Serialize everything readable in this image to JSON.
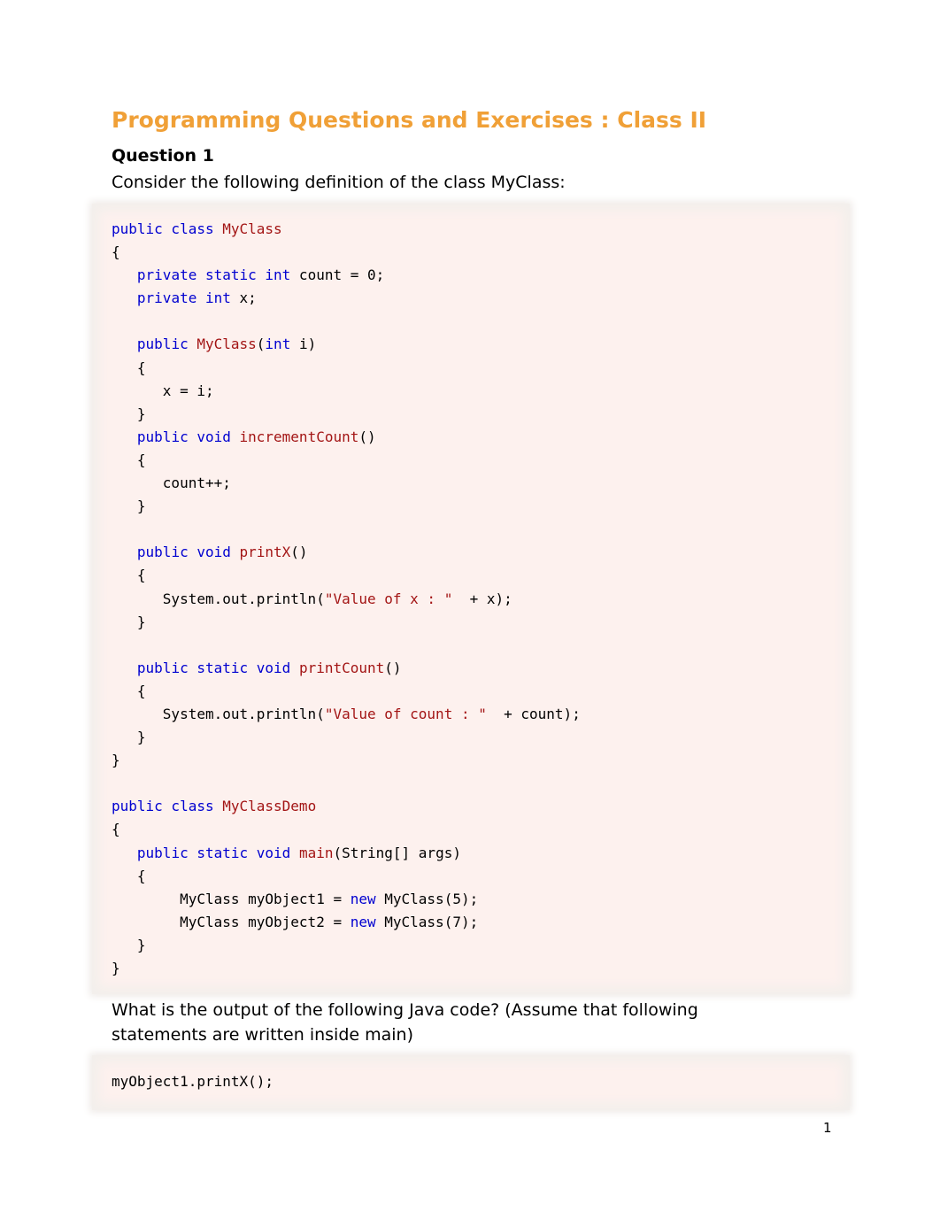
{
  "document": {
    "title": "Programming Questions and Exercises : Class II",
    "question_heading": "Question 1",
    "intro": "Consider the following definition of the class MyClass:",
    "question_line1": "What is the output of the following Java code? (Assume that following",
    "question_line2": "statements are written inside main)",
    "page_number": "1"
  },
  "code_block_1": [
    [
      [
        "kw",
        "public class "
      ],
      [
        "id",
        "MyClass"
      ]
    ],
    [
      [
        "t",
        "{"
      ]
    ],
    [
      [
        "t",
        "   "
      ],
      [
        "kw",
        "private static int"
      ],
      [
        "t",
        " count = 0;"
      ]
    ],
    [
      [
        "t",
        "   "
      ],
      [
        "kw",
        "private int"
      ],
      [
        "t",
        " x;"
      ]
    ],
    [
      [
        "t",
        ""
      ]
    ],
    [
      [
        "t",
        "   "
      ],
      [
        "kw",
        "public "
      ],
      [
        "id",
        "MyClass"
      ],
      [
        "t",
        "("
      ],
      [
        "kw",
        "int"
      ],
      [
        "t",
        " i)"
      ]
    ],
    [
      [
        "t",
        "   {"
      ]
    ],
    [
      [
        "t",
        "      x = i;"
      ]
    ],
    [
      [
        "t",
        "   }"
      ]
    ],
    [
      [
        "t",
        "   "
      ],
      [
        "kw",
        "public void "
      ],
      [
        "id",
        "incrementCount"
      ],
      [
        "t",
        "()"
      ]
    ],
    [
      [
        "t",
        "   {"
      ]
    ],
    [
      [
        "t",
        "      count++;"
      ]
    ],
    [
      [
        "t",
        "   }"
      ]
    ],
    [
      [
        "t",
        ""
      ]
    ],
    [
      [
        "t",
        "   "
      ],
      [
        "kw",
        "public void "
      ],
      [
        "id",
        "printX"
      ],
      [
        "t",
        "()"
      ]
    ],
    [
      [
        "t",
        "   {"
      ]
    ],
    [
      [
        "t",
        "      System.out.println("
      ],
      [
        "str",
        "\"Value of x : \""
      ],
      [
        "t",
        "  + x);"
      ]
    ],
    [
      [
        "t",
        "   }"
      ]
    ],
    [
      [
        "t",
        ""
      ]
    ],
    [
      [
        "t",
        "   "
      ],
      [
        "kw",
        "public static void "
      ],
      [
        "id",
        "printCount"
      ],
      [
        "t",
        "()"
      ]
    ],
    [
      [
        "t",
        "   {"
      ]
    ],
    [
      [
        "t",
        "      System.out.println("
      ],
      [
        "str",
        "\"Value of count : \""
      ],
      [
        "t",
        "  + count);"
      ]
    ],
    [
      [
        "t",
        "   }"
      ]
    ],
    [
      [
        "t",
        "}"
      ]
    ],
    [
      [
        "t",
        ""
      ]
    ],
    [
      [
        "kw",
        "public class "
      ],
      [
        "id",
        "MyClassDemo"
      ]
    ],
    [
      [
        "t",
        "{"
      ]
    ],
    [
      [
        "t",
        "   "
      ],
      [
        "kw",
        "public static void "
      ],
      [
        "id",
        "main"
      ],
      [
        "t",
        "(String[] args)"
      ]
    ],
    [
      [
        "t",
        "   {"
      ]
    ],
    [
      [
        "t",
        "        MyClass myObject1 = "
      ],
      [
        "kw",
        "new"
      ],
      [
        "t",
        " MyClass(5);"
      ]
    ],
    [
      [
        "t",
        "        MyClass myObject2 = "
      ],
      [
        "kw",
        "new"
      ],
      [
        "t",
        " MyClass(7);"
      ]
    ],
    [
      [
        "t",
        "   }"
      ]
    ],
    [
      [
        "t",
        "}"
      ]
    ]
  ],
  "code_block_2": [
    [
      [
        "t",
        "myObject1.printX();"
      ]
    ]
  ]
}
